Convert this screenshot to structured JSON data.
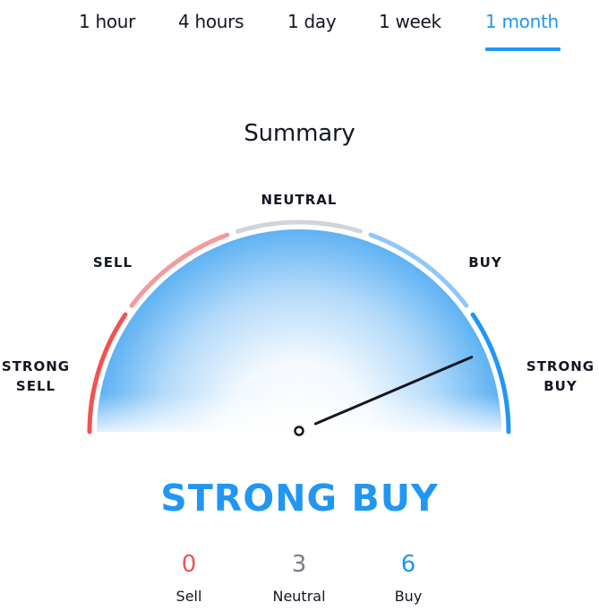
{
  "tabs": [
    {
      "label": "1 hour",
      "active": false
    },
    {
      "label": "4 hours",
      "active": false
    },
    {
      "label": "1 day",
      "active": false
    },
    {
      "label": "1 week",
      "active": false
    },
    {
      "label": "1 month",
      "active": true
    }
  ],
  "title": "Summary",
  "gauge": {
    "labels": {
      "strong_sell_1": "STRONG",
      "strong_sell_2": "SELL",
      "sell": "SELL",
      "neutral": "NEUTRAL",
      "buy": "BUY",
      "strong_buy_1": "STRONG",
      "strong_buy_2": "BUY"
    },
    "segment_colors": {
      "strong_sell": "#f05350",
      "sell": "#f5999a",
      "neutral": "#d1d4dc",
      "buy": "#90c7f7",
      "strong_buy": "#2196f3"
    },
    "needle_value": 0.87
  },
  "verdict": "STRONG BUY",
  "verdict_color": "#2196f3",
  "counts": {
    "sell": {
      "value": "0",
      "label": "Sell",
      "color": "#f05350"
    },
    "neutral": {
      "value": "3",
      "label": "Neutral",
      "color": "#787b86"
    },
    "buy": {
      "value": "6",
      "label": "Buy",
      "color": "#2196f3"
    }
  }
}
